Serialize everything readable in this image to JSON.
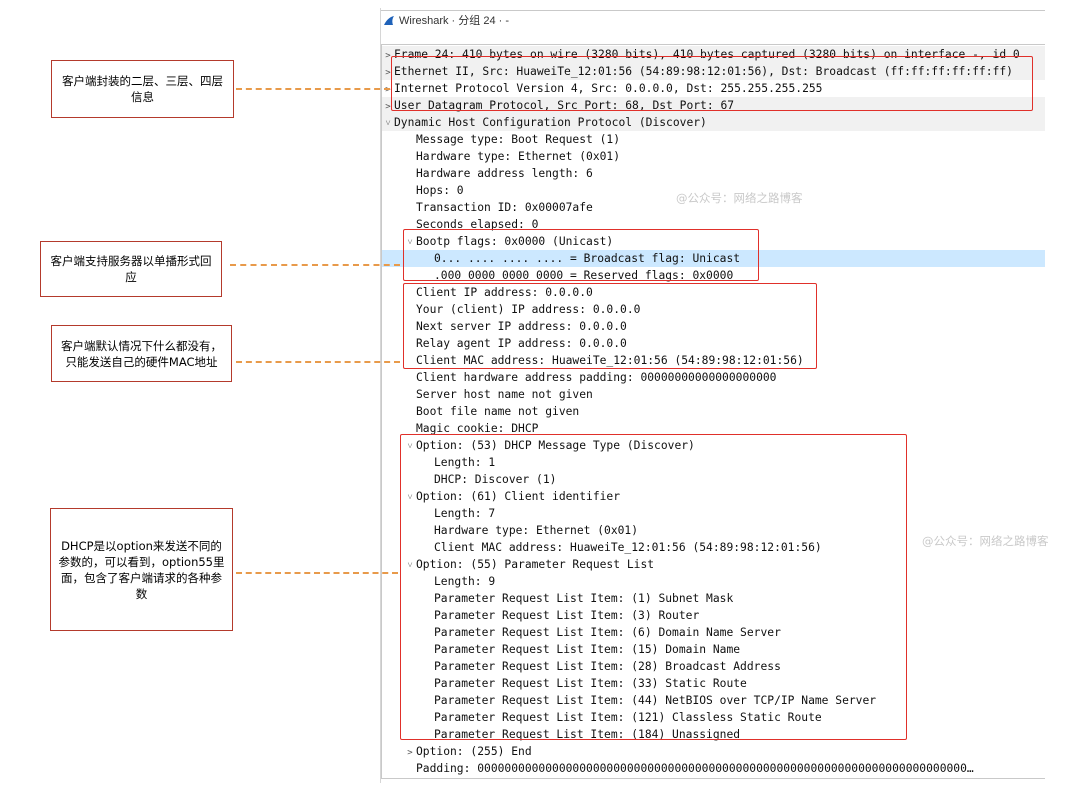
{
  "window": {
    "title": "Wireshark · 分组 24 · -"
  },
  "watermark": "@公众号：网络之路博客",
  "tree_rows": [
    {
      "arrow": ">",
      "indent": 0,
      "text": "Frame 24: 410 bytes on wire (3280 bits), 410 bytes captured (3280 bits) on interface -, id 0",
      "bg": "striped"
    },
    {
      "arrow": ">",
      "indent": 0,
      "text": "Ethernet II, Src: HuaweiTe_12:01:56 (54:89:98:12:01:56), Dst: Broadcast (ff:ff:ff:ff:ff:ff)",
      "bg": "striped"
    },
    {
      "arrow": ">",
      "indent": 0,
      "text": "Internet Protocol Version 4, Src: 0.0.0.0, Dst: 255.255.255.255",
      "bg": "none"
    },
    {
      "arrow": ">",
      "indent": 0,
      "text": "User Datagram Protocol, Src Port: 68, Dst Port: 67",
      "bg": "striped"
    },
    {
      "arrow": "v",
      "indent": 0,
      "text": "Dynamic Host Configuration Protocol (Discover)",
      "bg": "striped"
    },
    {
      "arrow": "",
      "indent": 1,
      "text": "Message type: Boot Request (1)",
      "bg": "none"
    },
    {
      "arrow": "",
      "indent": 1,
      "text": "Hardware type: Ethernet (0x01)",
      "bg": "none"
    },
    {
      "arrow": "",
      "indent": 1,
      "text": "Hardware address length: 6",
      "bg": "none"
    },
    {
      "arrow": "",
      "indent": 1,
      "text": "Hops: 0",
      "bg": "none"
    },
    {
      "arrow": "",
      "indent": 1,
      "text": "Transaction ID: 0x00007afe",
      "bg": "none"
    },
    {
      "arrow": "",
      "indent": 1,
      "text": "Seconds elapsed: 0",
      "bg": "none"
    },
    {
      "arrow": "v",
      "indent": 1,
      "text": "Bootp flags: 0x0000 (Unicast)",
      "bg": "none"
    },
    {
      "arrow": "",
      "indent": 2,
      "text": "0... .... .... .... = Broadcast flag: Unicast",
      "bg": "selected"
    },
    {
      "arrow": "",
      "indent": 2,
      "text": ".000 0000 0000 0000 = Reserved flags: 0x0000",
      "bg": "none"
    },
    {
      "arrow": "",
      "indent": 1,
      "text": "Client IP address: 0.0.0.0",
      "bg": "none"
    },
    {
      "arrow": "",
      "indent": 1,
      "text": "Your (client) IP address: 0.0.0.0",
      "bg": "none"
    },
    {
      "arrow": "",
      "indent": 1,
      "text": "Next server IP address: 0.0.0.0",
      "bg": "none"
    },
    {
      "arrow": "",
      "indent": 1,
      "text": "Relay agent IP address: 0.0.0.0",
      "bg": "none"
    },
    {
      "arrow": "",
      "indent": 1,
      "text": "Client MAC address: HuaweiTe_12:01:56 (54:89:98:12:01:56)",
      "bg": "none"
    },
    {
      "arrow": "",
      "indent": 1,
      "text": "Client hardware address padding: 00000000000000000000",
      "bg": "none"
    },
    {
      "arrow": "",
      "indent": 1,
      "text": "Server host name not given",
      "bg": "none"
    },
    {
      "arrow": "",
      "indent": 1,
      "text": "Boot file name not given",
      "bg": "none"
    },
    {
      "arrow": "",
      "indent": 1,
      "text": "Magic cookie: DHCP",
      "bg": "none"
    },
    {
      "arrow": "v",
      "indent": 1,
      "text": "Option: (53) DHCP Message Type (Discover)",
      "bg": "none"
    },
    {
      "arrow": "",
      "indent": 2,
      "text": "Length: 1",
      "bg": "none"
    },
    {
      "arrow": "",
      "indent": 2,
      "text": "DHCP: Discover (1)",
      "bg": "none"
    },
    {
      "arrow": "v",
      "indent": 1,
      "text": "Option: (61) Client identifier",
      "bg": "none"
    },
    {
      "arrow": "",
      "indent": 2,
      "text": "Length: 7",
      "bg": "none"
    },
    {
      "arrow": "",
      "indent": 2,
      "text": "Hardware type: Ethernet (0x01)",
      "bg": "none"
    },
    {
      "arrow": "",
      "indent": 2,
      "text": "Client MAC address: HuaweiTe_12:01:56 (54:89:98:12:01:56)",
      "bg": "none"
    },
    {
      "arrow": "v",
      "indent": 1,
      "text": "Option: (55) Parameter Request List",
      "bg": "none"
    },
    {
      "arrow": "",
      "indent": 2,
      "text": "Length: 9",
      "bg": "none"
    },
    {
      "arrow": "",
      "indent": 2,
      "text": "Parameter Request List Item: (1) Subnet Mask",
      "bg": "none"
    },
    {
      "arrow": "",
      "indent": 2,
      "text": "Parameter Request List Item: (3) Router",
      "bg": "none"
    },
    {
      "arrow": "",
      "indent": 2,
      "text": "Parameter Request List Item: (6) Domain Name Server",
      "bg": "none"
    },
    {
      "arrow": "",
      "indent": 2,
      "text": "Parameter Request List Item: (15) Domain Name",
      "bg": "none"
    },
    {
      "arrow": "",
      "indent": 2,
      "text": "Parameter Request List Item: (28) Broadcast Address",
      "bg": "none"
    },
    {
      "arrow": "",
      "indent": 2,
      "text": "Parameter Request List Item: (33) Static Route",
      "bg": "none"
    },
    {
      "arrow": "",
      "indent": 2,
      "text": "Parameter Request List Item: (44) NetBIOS over TCP/IP Name Server",
      "bg": "none"
    },
    {
      "arrow": "",
      "indent": 2,
      "text": "Parameter Request List Item: (121) Classless Static Route",
      "bg": "none"
    },
    {
      "arrow": "",
      "indent": 2,
      "text": "Parameter Request List Item: (184) Unassigned",
      "bg": "none"
    },
    {
      "arrow": ">",
      "indent": 1,
      "text": "Option: (255) End",
      "bg": "none"
    },
    {
      "arrow": "",
      "indent": 1,
      "text": "Padding: 000000000000000000000000000000000000000000000000000000000000000000000000…",
      "bg": "none"
    }
  ],
  "annotations": [
    {
      "text": "客户端封装的二层、三层、四层信息"
    },
    {
      "text": "客户端支持服务器以单播形式回应"
    },
    {
      "text": "客户端默认情况下什么都没有，只能发送自己的硬件MAC地址"
    },
    {
      "text": "DHCP是以option来发送不同的参数的，可以看到，option55里面，包含了客户端请求的各种参数"
    }
  ],
  "colors": {
    "highlight_box": "#e0302a",
    "callout_border": "#b43a2c",
    "leader_line": "#e89a4a",
    "selected_row": "#cce8ff",
    "wireshark_fin": "#1f62b9"
  }
}
